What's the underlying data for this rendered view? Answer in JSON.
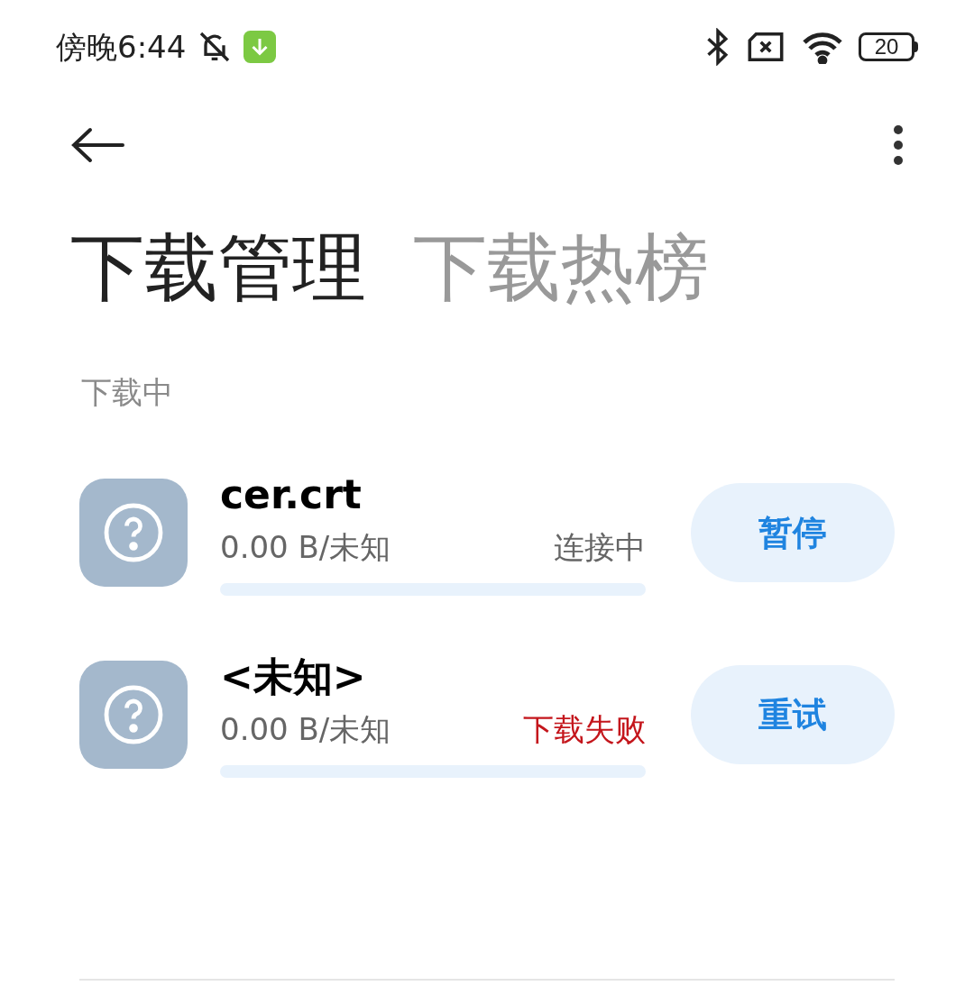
{
  "status_bar": {
    "time": "傍晚6:44",
    "battery": "20"
  },
  "tabs": [
    {
      "label": "下载管理",
      "selected": true
    },
    {
      "label": "下载热榜",
      "selected": false
    }
  ],
  "section": {
    "title": "下载中"
  },
  "downloads": [
    {
      "name": "cer.crt",
      "size": "0.00 B/未知",
      "status": "连接中",
      "kind": "normal",
      "level": 0,
      "action": "暂停"
    },
    {
      "name": "<未知>",
      "size": "0.00 B/未知",
      "status": "下载失败",
      "kind": "error",
      "level": 0,
      "action": "重试"
    }
  ]
}
